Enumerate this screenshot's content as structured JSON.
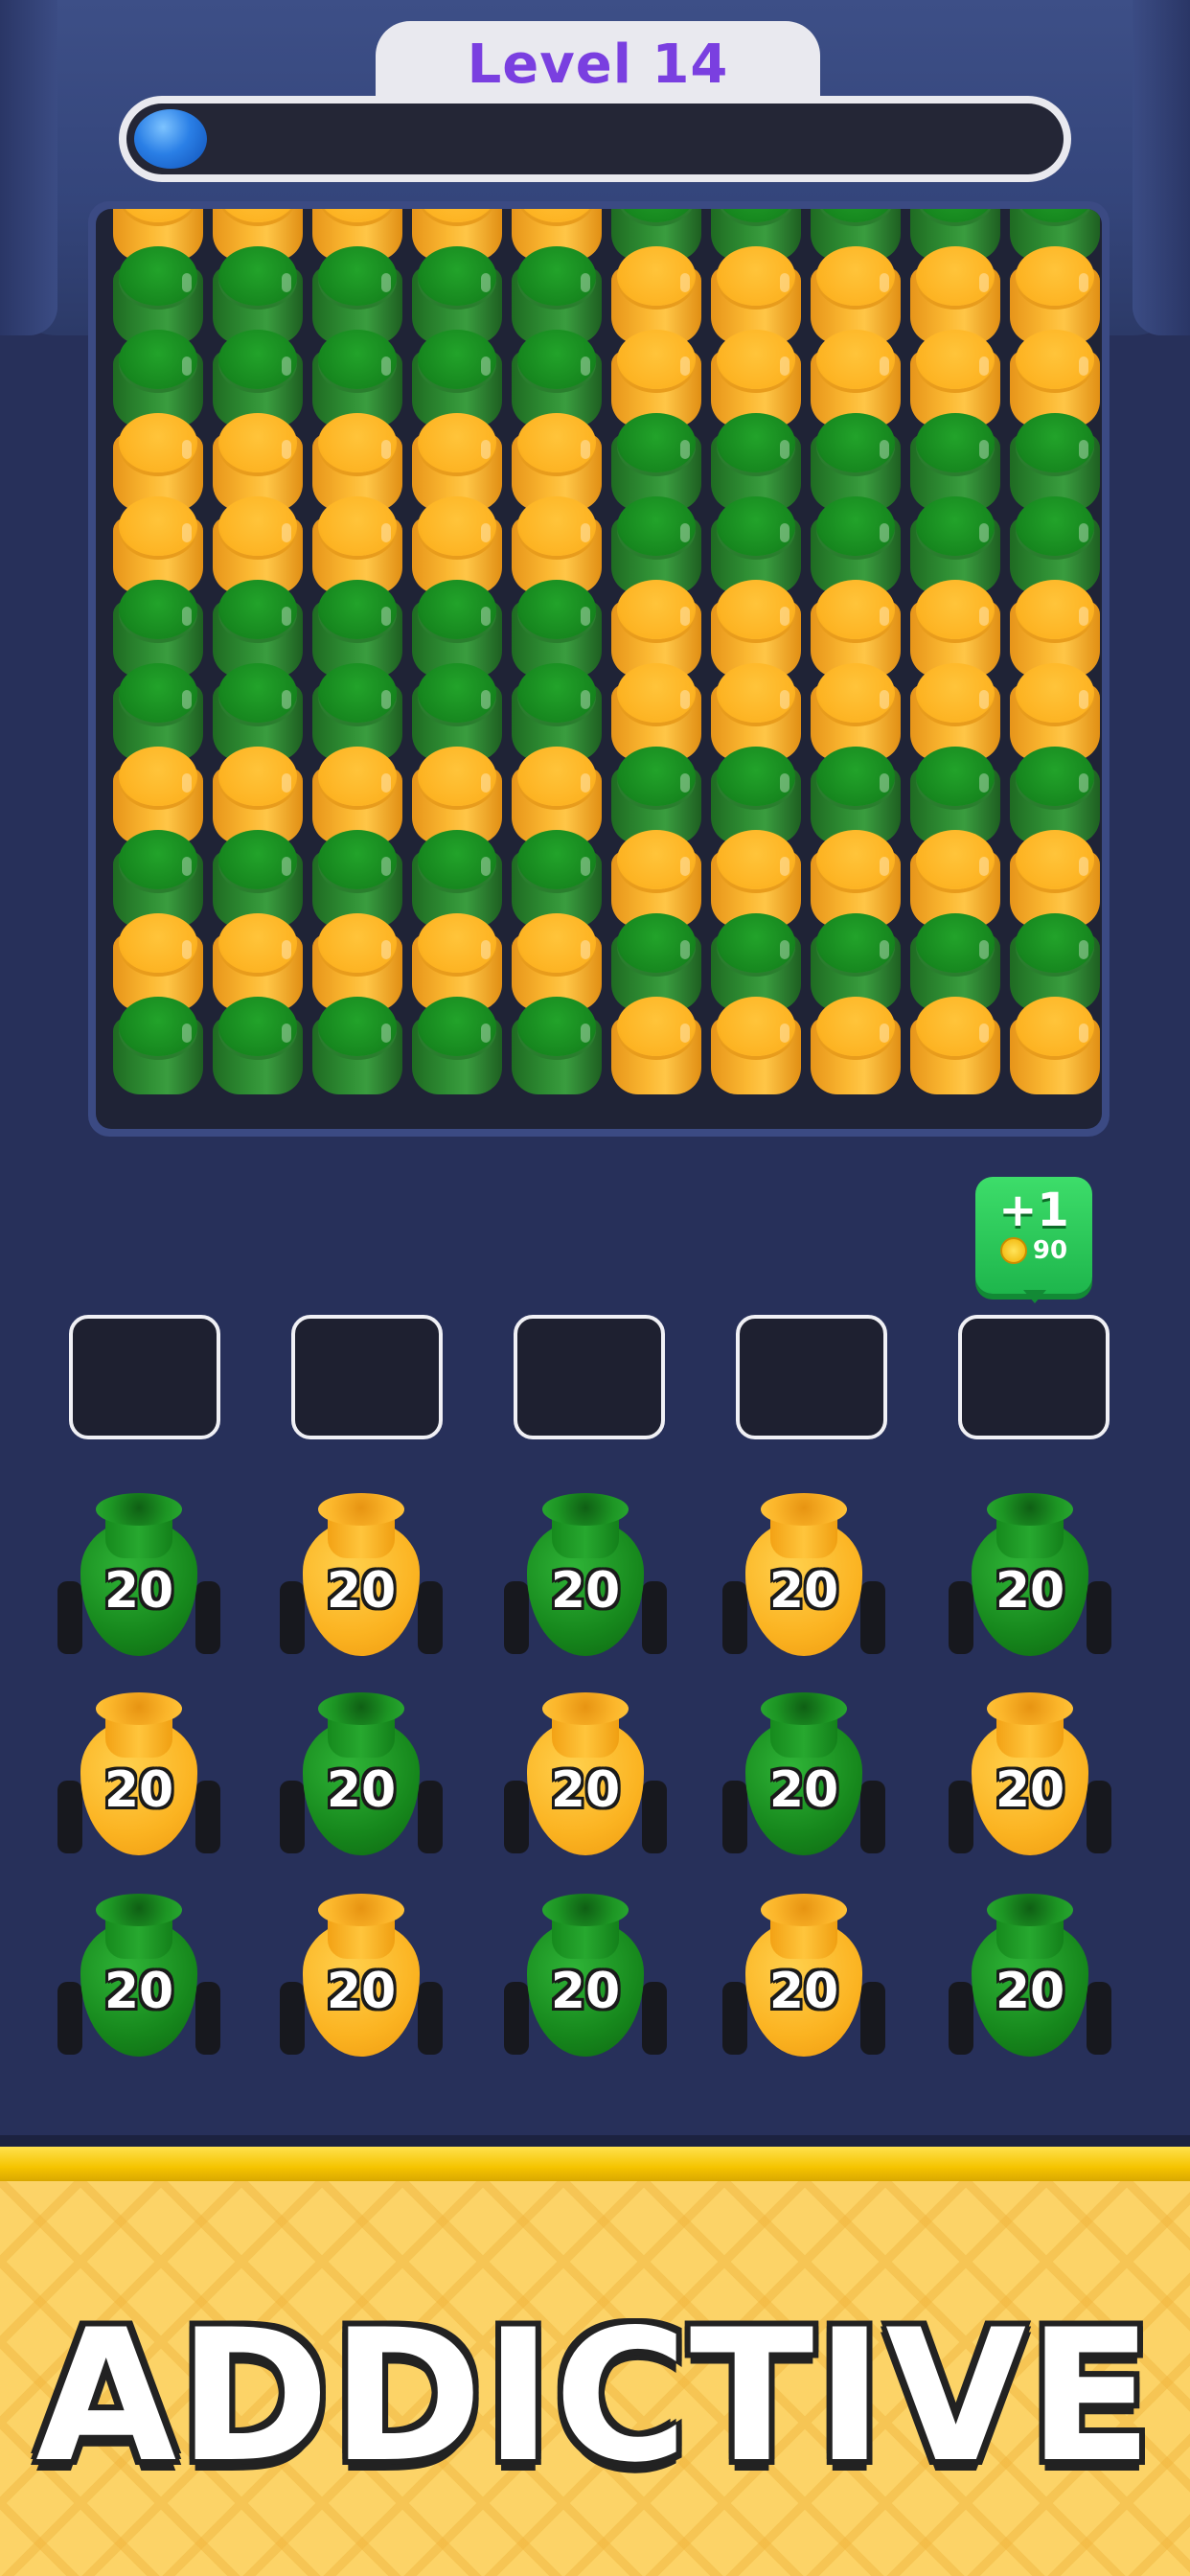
{
  "header": {
    "level_label": "Level 14",
    "progress": 0
  },
  "colors": {
    "green": "#1e8f26",
    "yellow": "#fbb729",
    "background": "#27305a",
    "banner": "#fcd367",
    "level_text": "#7a3fe0"
  },
  "board": {
    "columns": 10,
    "rows": 11,
    "grid": [
      [
        "yellow",
        "yellow",
        "yellow",
        "yellow",
        "yellow",
        "green",
        "green",
        "green",
        "green",
        "green"
      ],
      [
        "green",
        "green",
        "green",
        "green",
        "green",
        "yellow",
        "yellow",
        "yellow",
        "yellow",
        "yellow"
      ],
      [
        "green",
        "green",
        "green",
        "green",
        "green",
        "yellow",
        "yellow",
        "yellow",
        "yellow",
        "yellow"
      ],
      [
        "yellow",
        "yellow",
        "yellow",
        "yellow",
        "yellow",
        "green",
        "green",
        "green",
        "green",
        "green"
      ],
      [
        "yellow",
        "yellow",
        "yellow",
        "yellow",
        "yellow",
        "green",
        "green",
        "green",
        "green",
        "green"
      ],
      [
        "green",
        "green",
        "green",
        "green",
        "green",
        "yellow",
        "yellow",
        "yellow",
        "yellow",
        "yellow"
      ],
      [
        "green",
        "green",
        "green",
        "green",
        "green",
        "yellow",
        "yellow",
        "yellow",
        "yellow",
        "yellow"
      ],
      [
        "yellow",
        "yellow",
        "yellow",
        "yellow",
        "yellow",
        "green",
        "green",
        "green",
        "green",
        "green"
      ],
      [
        "green",
        "green",
        "green",
        "green",
        "green",
        "yellow",
        "yellow",
        "yellow",
        "yellow",
        "yellow"
      ],
      [
        "yellow",
        "yellow",
        "yellow",
        "yellow",
        "yellow",
        "green",
        "green",
        "green",
        "green",
        "green"
      ],
      [
        "green",
        "green",
        "green",
        "green",
        "green",
        "yellow",
        "yellow",
        "yellow",
        "yellow",
        "yellow"
      ]
    ]
  },
  "bonus": {
    "label": "+1",
    "cost": "90",
    "icon": "coin-icon"
  },
  "slots": {
    "count": 5
  },
  "shooters": [
    [
      {
        "color": "green",
        "count": "20"
      },
      {
        "color": "yellow",
        "count": "20"
      },
      {
        "color": "green",
        "count": "20"
      },
      {
        "color": "yellow",
        "count": "20"
      },
      {
        "color": "green",
        "count": "20"
      }
    ],
    [
      {
        "color": "yellow",
        "count": "20"
      },
      {
        "color": "green",
        "count": "20"
      },
      {
        "color": "yellow",
        "count": "20"
      },
      {
        "color": "green",
        "count": "20"
      },
      {
        "color": "yellow",
        "count": "20"
      }
    ],
    [
      {
        "color": "green",
        "count": "20"
      },
      {
        "color": "yellow",
        "count": "20"
      },
      {
        "color": "green",
        "count": "20"
      },
      {
        "color": "yellow",
        "count": "20"
      },
      {
        "color": "green",
        "count": "20"
      }
    ]
  ],
  "banner": {
    "text": "ADDICTIVE"
  }
}
